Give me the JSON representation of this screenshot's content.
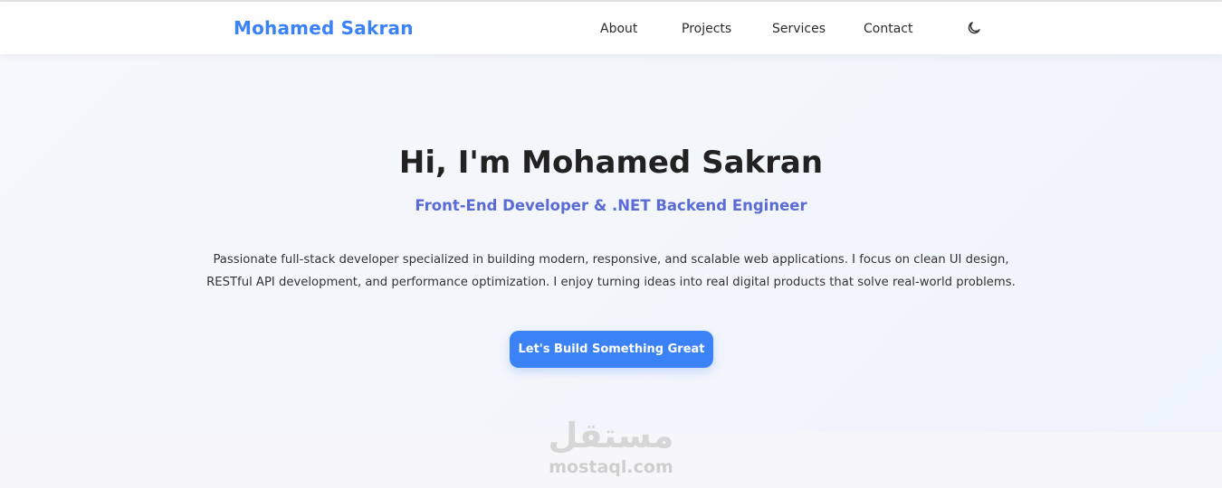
{
  "header": {
    "brand": "Mohamed Sakran",
    "nav": [
      {
        "label": "About"
      },
      {
        "label": "Projects"
      },
      {
        "label": "Services"
      },
      {
        "label": "Contact"
      }
    ],
    "theme_toggle_icon": "moon-icon"
  },
  "hero": {
    "title": "Hi, I'm Mohamed Sakran",
    "subtitle": "Front-End Developer & .NET Backend Engineer",
    "description": "Passionate full-stack developer specialized in building modern, responsive, and scalable web applications. I focus on clean UI design, RESTful API development, and performance optimization. I enjoy turning ideas into real digital products that solve real-world problems.",
    "cta_label": "Let's Build Something Great"
  },
  "watermark": {
    "arabic": "مستقل",
    "latin": "mostaql.com"
  },
  "colors": {
    "accent": "#3b82f6",
    "subtitle": "#5b6bd6",
    "text": "#222222"
  }
}
